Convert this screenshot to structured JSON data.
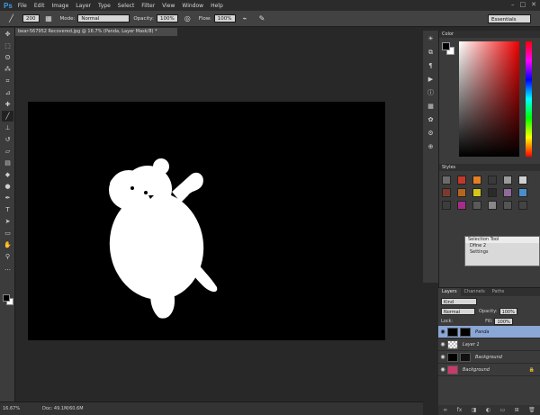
{
  "app": {
    "logo": "Ps",
    "menus": [
      "File",
      "Edit",
      "Image",
      "Layer",
      "Type",
      "Select",
      "Filter",
      "View",
      "Window",
      "Help"
    ],
    "window_controls": [
      "–",
      "□",
      "✕"
    ]
  },
  "options_bar": {
    "brush_size": "200",
    "mode_label": "Mode:",
    "mode_value": "Normal",
    "opacity_label": "Opacity:",
    "opacity_value": "100%",
    "flow_label": "Flow:",
    "flow_value": "100%",
    "workspace": "Essentials"
  },
  "document": {
    "tab_title": "bear-567952 Recovered.jpg @ 16.7% (Panda, Layer Mask/8) *",
    "zoom": "16.67%",
    "doc_size": "Doc: 49.1M/60.6M"
  },
  "panels": {
    "color_tab": "Color",
    "styles_tab": "Styles",
    "style_swatches": [
      "#6b6b6b",
      "#c0392b",
      "#e67e22",
      "#3a3a3a",
      "#9b9b9b",
      "#d0d0d0",
      "#7a3b2e",
      "#b5651d",
      "#d4c51a",
      "#2a2a2a",
      "#8f6a9a",
      "#4a8fc9",
      "#3d3d3d",
      "#a72b8c",
      "#5a5a5a",
      "#888888",
      "#555555",
      "#444444"
    ]
  },
  "selection_tool": {
    "title": "Selection Tool",
    "item": "Dfine 2",
    "settings": "Settings"
  },
  "layers_panel": {
    "tabs": [
      "Layers",
      "Channels",
      "Paths"
    ],
    "kind": "Kind",
    "blend_mode": "Normal",
    "opacity_label": "Opacity:",
    "opacity_value": "100%",
    "lock_label": "Lock:",
    "fill_label": "Fill:",
    "fill_value": "100%",
    "layers": [
      {
        "name": "Panda",
        "active": true
      },
      {
        "name": "Layer 1",
        "active": false
      },
      {
        "name": "Background",
        "active": false
      },
      {
        "name": "Background",
        "active": false
      }
    ]
  }
}
